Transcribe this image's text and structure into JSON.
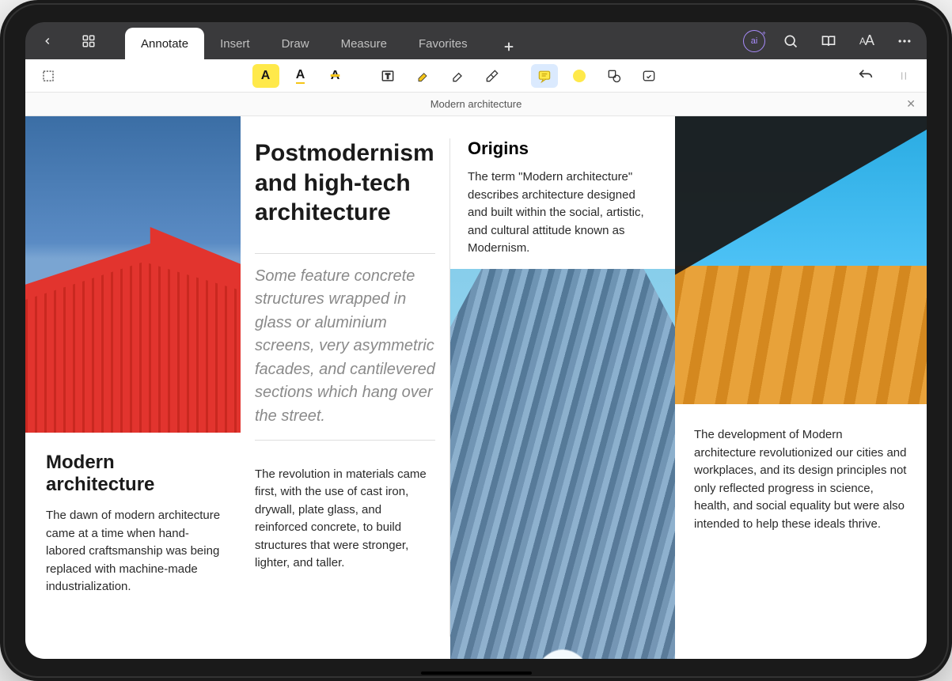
{
  "tabs": {
    "annotate": "Annotate",
    "insert": "Insert",
    "draw": "Draw",
    "measure": "Measure",
    "favorites": "Favorites"
  },
  "ai_label": "ai",
  "doc_title": "Modern architecture",
  "col1": {
    "heading": "Modern architecture",
    "body": "The dawn of modern architecture came at a time when hand-labored craftsmanship was being replaced with machine-made industrialization."
  },
  "col2": {
    "heading": "Postmodernism and high-tech architecture",
    "lead": "Some feature concrete structures wrapped in glass  or aluminium screens, very asymmetric facades, and cantilevered sections which hang over the street.",
    "body": "The revolution in materials came first, with the use of cast iron, drywall, plate glass, and reinforced concrete, to build structures that were stronger, lighter, and taller."
  },
  "col3": {
    "heading": "Origins",
    "body": "The term \"Modern architecture\" describes architecture designed and built within the social, artistic, and cultural attitude known as Modernism."
  },
  "col4": {
    "body": "The development of Modern architecture revolutionized our cities and workplaces, and its design principles not only reflected progress in science, health, and social equality but were also intended to help these ideals thrive."
  }
}
